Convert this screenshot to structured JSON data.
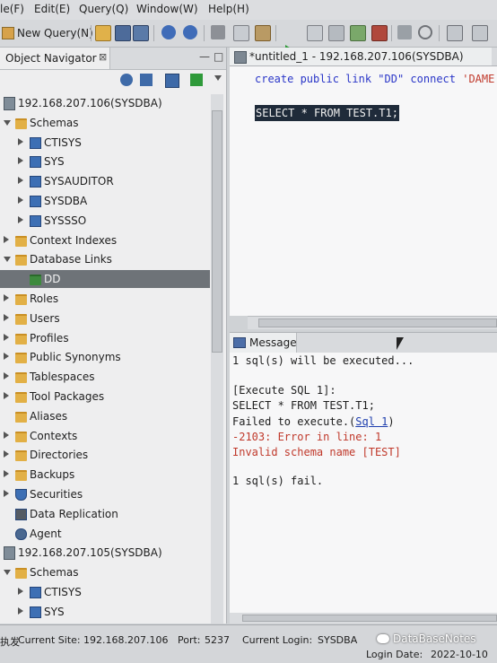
{
  "menubar": {
    "items": [
      "le(F)",
      "Edit(E)",
      "Query(Q)",
      "Window(W)",
      "Help(H)"
    ]
  },
  "toolbar": {
    "new_query_label": "New Query(N)",
    "buttons": [
      "open-folder-icon",
      "save-icon",
      "save-as-icon",
      "save-all-icon",
      "undo-icon",
      "redo-icon",
      "cut-icon",
      "copy-icon",
      "paste-icon",
      "run-icon",
      "run-script-icon",
      "explain-icon",
      "export-icon",
      "stop-icon",
      "commit-icon",
      "rollback-icon",
      "settings-icon",
      "grid-icon"
    ]
  },
  "navigator": {
    "title": "Object Navigator",
    "close_glyph": "⊠",
    "tree": [
      {
        "label": "192.168.207.106(SYSDBA)",
        "icon": "server",
        "level": 0,
        "state": "none"
      },
      {
        "label": "Schemas",
        "icon": "folder",
        "level": 1,
        "state": "open"
      },
      {
        "label": "CTISYS",
        "icon": "schema",
        "level": 2,
        "state": "closed"
      },
      {
        "label": "SYS",
        "icon": "schema",
        "level": 2,
        "state": "closed"
      },
      {
        "label": "SYSAUDITOR",
        "icon": "schema",
        "level": 2,
        "state": "closed"
      },
      {
        "label": "SYSDBA",
        "icon": "schema",
        "level": 2,
        "state": "closed"
      },
      {
        "label": "SYSSSO",
        "icon": "schema",
        "level": 2,
        "state": "closed"
      },
      {
        "label": "Context Indexes",
        "icon": "folder",
        "level": 1,
        "state": "closed"
      },
      {
        "label": "Database Links",
        "icon": "folder",
        "level": 1,
        "state": "open"
      },
      {
        "label": "DD",
        "icon": "link",
        "level": 2,
        "state": "none",
        "selected": true
      },
      {
        "label": "Roles",
        "icon": "folder",
        "level": 1,
        "state": "closed"
      },
      {
        "label": "Users",
        "icon": "folder",
        "level": 1,
        "state": "closed"
      },
      {
        "label": "Profiles",
        "icon": "folder",
        "level": 1,
        "state": "closed"
      },
      {
        "label": "Public Synonyms",
        "icon": "folder",
        "level": 1,
        "state": "closed"
      },
      {
        "label": "Tablespaces",
        "icon": "folder",
        "level": 1,
        "state": "closed"
      },
      {
        "label": "Tool Packages",
        "icon": "folder",
        "level": 1,
        "state": "closed"
      },
      {
        "label": "Aliases",
        "icon": "folder",
        "level": 1,
        "state": "none"
      },
      {
        "label": "Contexts",
        "icon": "folder",
        "level": 1,
        "state": "closed"
      },
      {
        "label": "Directories",
        "icon": "folder",
        "level": 1,
        "state": "closed"
      },
      {
        "label": "Backups",
        "icon": "folder",
        "level": 1,
        "state": "closed"
      },
      {
        "label": "Securities",
        "icon": "shield",
        "level": 1,
        "state": "closed"
      },
      {
        "label": "Data Replication",
        "icon": "replication",
        "level": 1,
        "state": "none"
      },
      {
        "label": "Agent",
        "icon": "agent",
        "level": 1,
        "state": "none"
      },
      {
        "label": "192.168.207.105(SYSDBA)",
        "icon": "server",
        "level": 0,
        "state": "none"
      },
      {
        "label": "Schemas",
        "icon": "folder",
        "level": 1,
        "state": "open"
      },
      {
        "label": "CTISYS",
        "icon": "schema",
        "level": 2,
        "state": "closed"
      },
      {
        "label": "SYS",
        "icon": "schema",
        "level": 2,
        "state": "closed"
      }
    ]
  },
  "editor": {
    "tab_label": "*untitled_1 - 192.168.207.106(SYSDBA)",
    "tab_close_glyph": "⊠",
    "line1": {
      "kw1": "create public link",
      "str1": "\"DD\"",
      "kw2": "connect",
      "str2": "'DAME"
    },
    "line2": "SELECT * FROM TEST.T1;"
  },
  "messages": {
    "tab_label": "Message",
    "lines": {
      "l1": "1 sql(s) will be executed...",
      "l2": "[Execute SQL 1]:",
      "l3": "SELECT * FROM TEST.T1;",
      "l4_prefix": "Failed to execute.(",
      "l4_link": "Sql 1",
      "l4_suffix": ")",
      "l5": "-2103: Error in line: 1",
      "l6": "Invalid schema name [TEST]",
      "l7": "1 sql(s) fail."
    }
  },
  "status": {
    "prefix": "执发",
    "current_site_label": "Current Site:",
    "current_site": "192.168.207.106",
    "port_label": "Port:",
    "port": "5237",
    "login_label": "Current Login:",
    "login": "SYSDBA",
    "login_date_label": "Login Date:",
    "login_date": "2022-10-10",
    "watermark": "DataBaseNotes"
  },
  "colors": {
    "accent": "#2a36c8",
    "error": "#c0392b",
    "selection": "#1f2b3a"
  }
}
